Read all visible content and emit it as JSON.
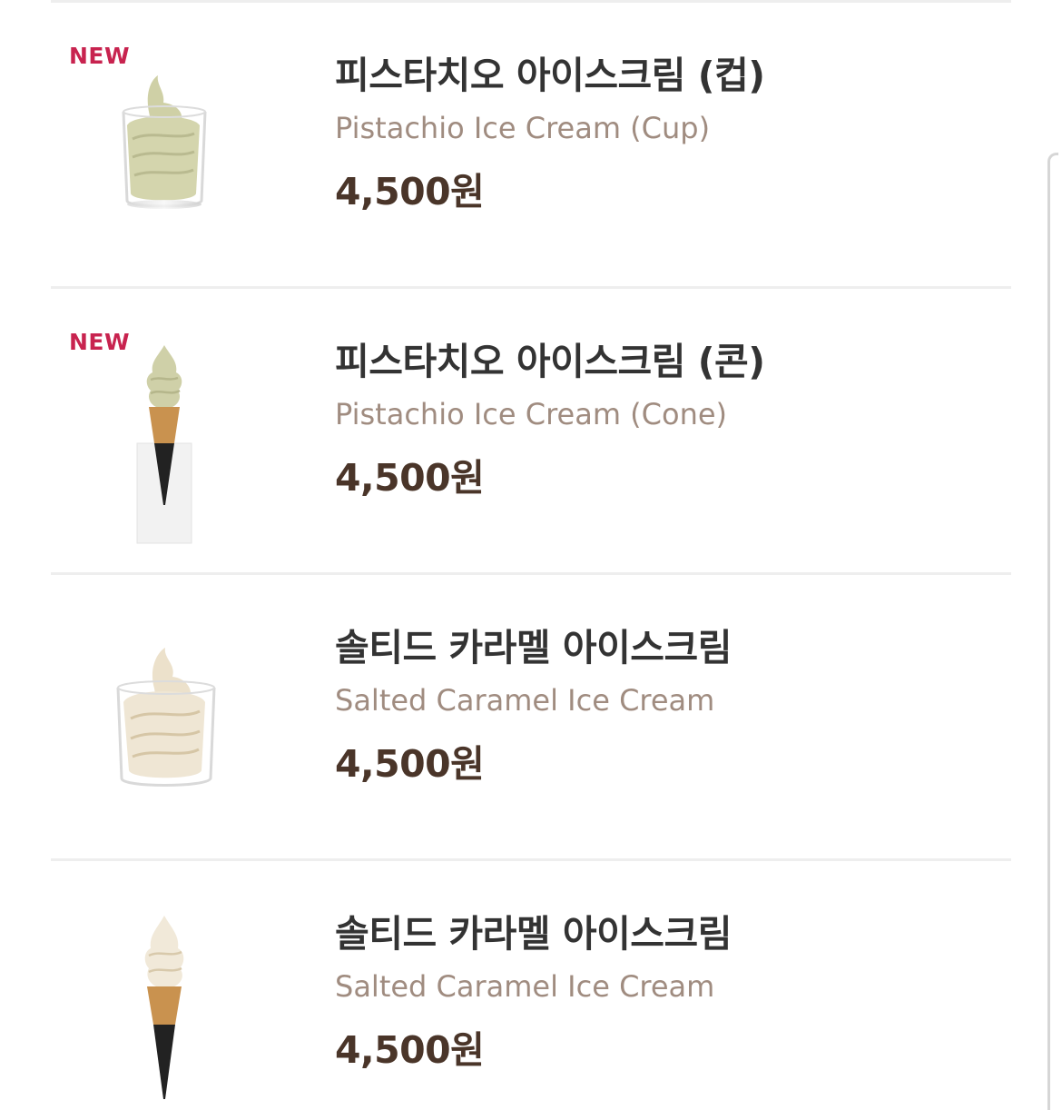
{
  "items": [
    {
      "badge": "NEW",
      "name_ko": "피스타치오 아이스크림 (컵)",
      "name_en": "Pistachio Ice Cream (Cup)",
      "price": "4,500원",
      "image": "pistachio-cup-icon"
    },
    {
      "badge": "NEW",
      "name_ko": "피스타치오 아이스크림 (콘)",
      "name_en": "Pistachio Ice Cream (Cone)",
      "price": "4,500원",
      "image": "pistachio-cone-icon"
    },
    {
      "badge": "",
      "name_ko": "솔티드 카라멜 아이스크림",
      "name_en": "Salted Caramel Ice Cream",
      "price": "4,500원",
      "image": "caramel-cup-icon"
    },
    {
      "badge": "",
      "name_ko": "솔티드 카라멜 아이스크림",
      "name_en": "Salted Caramel Ice Cream",
      "price": "4,500원",
      "image": "caramel-cone-icon"
    }
  ],
  "colors": {
    "badge": "#c8234f",
    "title": "#333333",
    "subtitle": "#a08c80",
    "price": "#4a3529",
    "pistachio": "#d3d4ad",
    "caramel": "#efe6d4"
  }
}
